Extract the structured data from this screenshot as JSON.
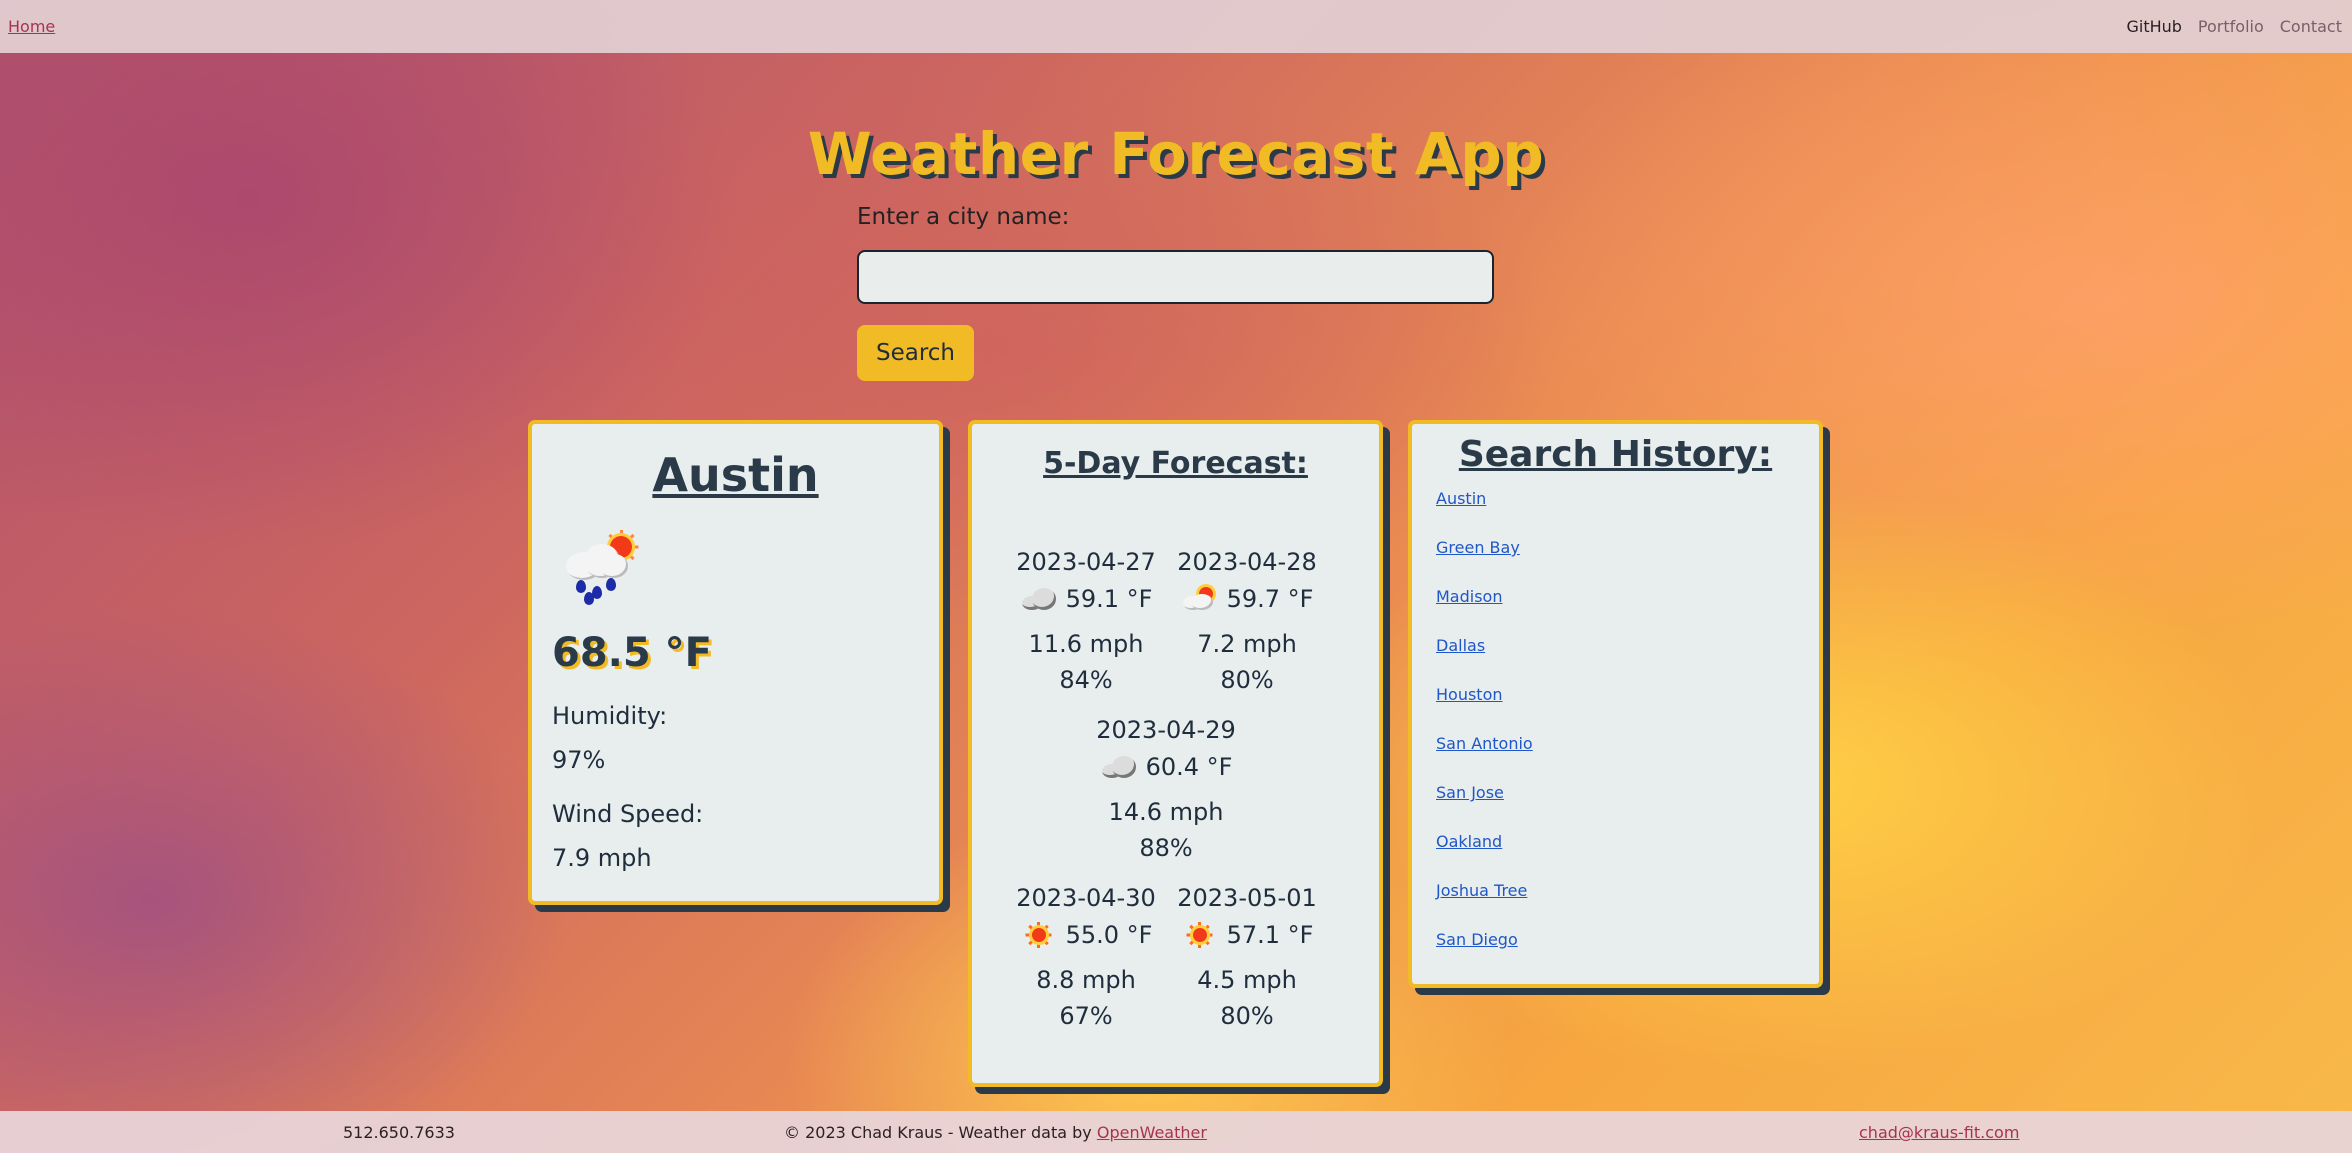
{
  "nav": {
    "home": "Home",
    "links": [
      "GitHub",
      "Portfolio",
      "Contact"
    ]
  },
  "app": {
    "title": "Weather Forecast App",
    "city_label": "Enter a city name:",
    "search_value": "",
    "search_button": "Search"
  },
  "current": {
    "city": "Austin",
    "icon": "rain-cloud-sun-icon",
    "temp": "68.5 °F",
    "humidity_label": "Humidity:",
    "humidity": "97%",
    "wind_label": "Wind Speed:",
    "wind": "7.9 mph"
  },
  "forecast": {
    "title": "5-Day Forecast:",
    "days": [
      {
        "date": "2023-04-27",
        "icon": "cloud-icon",
        "temp": "59.1 °F",
        "wind": "11.6 mph",
        "humidity": "84%"
      },
      {
        "date": "2023-04-28",
        "icon": "cloud-sun-icon",
        "temp": "59.7 °F",
        "wind": "7.2 mph",
        "humidity": "80%"
      },
      {
        "date": "2023-04-29",
        "icon": "cloud-icon",
        "temp": "60.4 °F",
        "wind": "14.6 mph",
        "humidity": "88%"
      },
      {
        "date": "2023-04-30",
        "icon": "sun-icon",
        "temp": "55.0 °F",
        "wind": "8.8 mph",
        "humidity": "67%"
      },
      {
        "date": "2023-05-01",
        "icon": "sun-icon",
        "temp": "57.1 °F",
        "wind": "4.5 mph",
        "humidity": "80%"
      }
    ]
  },
  "history": {
    "title": "Search History:",
    "cities": [
      "Austin",
      "Green Bay",
      "Madison",
      "Dallas",
      "Houston",
      "San Antonio",
      "San Jose",
      "Oakland",
      "Joshua Tree",
      "San Diego"
    ]
  },
  "footer": {
    "phone": "512.650.7633",
    "copyright": "© 2023 Chad Kraus - Weather data by ",
    "copyright_link": "OpenWeather",
    "email": "chad@kraus-fit.com"
  },
  "colors": {
    "accent": "#f0bb25",
    "card_bg": "#e8eeed",
    "shadow": "#2b3a48",
    "link": "#1f56c8",
    "nav_link": "#a8334e"
  }
}
